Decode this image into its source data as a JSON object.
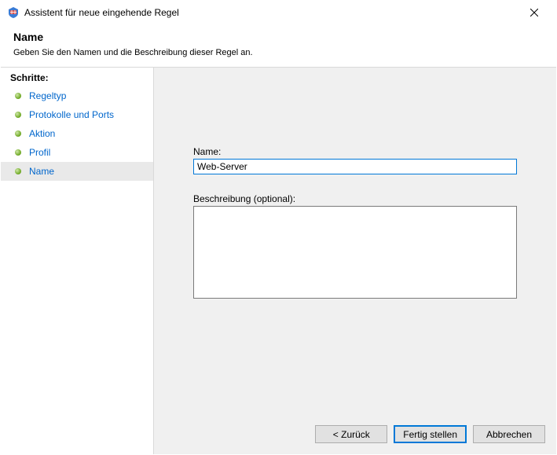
{
  "window": {
    "title": "Assistent für neue eingehende Regel"
  },
  "header": {
    "heading": "Name",
    "subtitle": "Geben Sie den Namen und die Beschreibung dieser Regel an."
  },
  "sidebar": {
    "steps_title": "Schritte:",
    "items": [
      {
        "label": "Regeltyp"
      },
      {
        "label": "Protokolle und Ports"
      },
      {
        "label": "Aktion"
      },
      {
        "label": "Profil"
      },
      {
        "label": "Name"
      }
    ]
  },
  "form": {
    "name_label": "Name:",
    "name_value": "Web-Server",
    "desc_label": "Beschreibung (optional):",
    "desc_value": ""
  },
  "buttons": {
    "back": "< Zurück",
    "finish": "Fertig stellen",
    "cancel": "Abbrechen"
  }
}
